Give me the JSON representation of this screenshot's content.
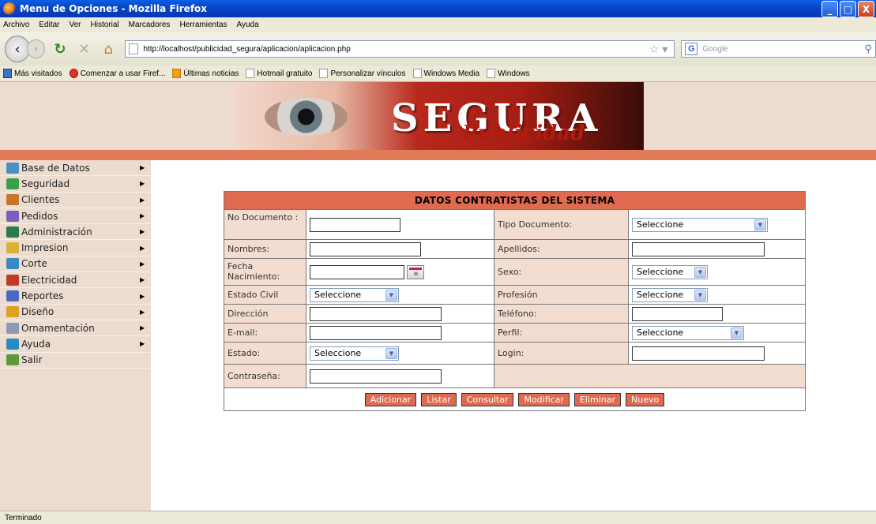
{
  "window": {
    "title": "Menu de Opciones - Mozilla Firefox",
    "buttons": {
      "minimize": "_",
      "maximize": "□",
      "close": "X"
    }
  },
  "menubar": [
    "Archivo",
    "Editar",
    "Ver",
    "Historial",
    "Marcadores",
    "Herramientas",
    "Ayuda"
  ],
  "navbar": {
    "url": "http://localhost/publicidad_segura/aplicacion/aplicacion.php",
    "search_placeholder": "Google",
    "search_engine_icon": "G"
  },
  "bookmarks": [
    {
      "label": "Más visitados",
      "icon": "blue"
    },
    {
      "label": "Comenzar a usar Firef...",
      "icon": "red"
    },
    {
      "label": "Últimas noticias",
      "icon": "rss"
    },
    {
      "label": "Hotmail gratuito",
      "icon": "page"
    },
    {
      "label": "Personalizar vínculos",
      "icon": "page"
    },
    {
      "label": "Windows Media",
      "icon": "page"
    },
    {
      "label": "Windows",
      "icon": "page"
    }
  ],
  "banner": {
    "brand": "SEGURA",
    "sub": "Publicidad"
  },
  "sidebar": {
    "items": [
      {
        "label": "Base de Datos",
        "color": "#4a90c2",
        "has_arrow": true
      },
      {
        "label": "Seguridad",
        "color": "#3aa04a",
        "has_arrow": true
      },
      {
        "label": "Clientes",
        "color": "#c8742a",
        "has_arrow": true
      },
      {
        "label": "Pedidos",
        "color": "#7a5fc2",
        "has_arrow": true
      },
      {
        "label": "Administración",
        "color": "#2a7a4a",
        "has_arrow": true
      },
      {
        "label": "Impresion",
        "color": "#d9b23a",
        "has_arrow": true
      },
      {
        "label": "Corte",
        "color": "#3a8ac2",
        "has_arrow": true
      },
      {
        "label": "Electricidad",
        "color": "#c23a2a",
        "has_arrow": true
      },
      {
        "label": "Reportes",
        "color": "#4a6ac2",
        "has_arrow": true
      },
      {
        "label": "Diseño",
        "color": "#e0a020",
        "has_arrow": true
      },
      {
        "label": "Ornamentación",
        "color": "#8a9ab2",
        "has_arrow": true
      },
      {
        "label": "Ayuda",
        "color": "#2a8ac2",
        "has_arrow": true
      },
      {
        "label": "Salir",
        "color": "#5a9a3a",
        "has_arrow": false
      }
    ]
  },
  "form": {
    "title": "DATOS CONTRATISTAS DEL SISTEMA",
    "rows": [
      {
        "l1": "No Documento :",
        "f1": {
          "type": "text",
          "w": 115
        },
        "l2": "Tipo Documento:",
        "f2": {
          "type": "select",
          "value": "Seleccione",
          "w": 172
        },
        "h": 38
      },
      {
        "l1": "Nombres:",
        "f1": {
          "type": "text",
          "w": 141
        },
        "l2": "Apellidos:",
        "f2": {
          "type": "text",
          "w": 168
        },
        "h": 24
      },
      {
        "l1": "Fecha Nacimiento:",
        "f1": {
          "type": "date",
          "w": 120
        },
        "l2": "Sexo:",
        "f2": {
          "type": "select",
          "value": "Seleccione",
          "w": 96
        },
        "h": 34
      },
      {
        "l1": "Estado Civil",
        "f1": {
          "type": "select",
          "value": "Seleccione",
          "w": 113
        },
        "l2": "Profesión",
        "f2": {
          "type": "select",
          "value": "Seleccione",
          "w": 96
        },
        "h": 24
      },
      {
        "l1": "Dirección",
        "f1": {
          "type": "text",
          "w": 167
        },
        "l2": "Teléfono:",
        "f2": {
          "type": "text",
          "w": 115
        },
        "h": 24
      },
      {
        "l1": "E-mail:",
        "f1": {
          "type": "text",
          "w": 167
        },
        "l2": "Perfil:",
        "f2": {
          "type": "select",
          "value": "Seleccione",
          "w": 142
        },
        "h": 24
      },
      {
        "l1": "Estado:",
        "f1": {
          "type": "select",
          "value": "Seleccione",
          "w": 113
        },
        "l2": "Login:",
        "f2": {
          "type": "text",
          "w": 168
        },
        "h": 28
      },
      {
        "l1": "Contraseña:",
        "f1": {
          "type": "password",
          "w": 167
        },
        "l2": "",
        "f2": null,
        "h": 30
      }
    ],
    "buttons": [
      "Adicionar",
      "Listar",
      "Consultar",
      "Modificar",
      "Eliminar",
      "Nuevo"
    ]
  },
  "statusbar": {
    "text": "Terminado"
  }
}
